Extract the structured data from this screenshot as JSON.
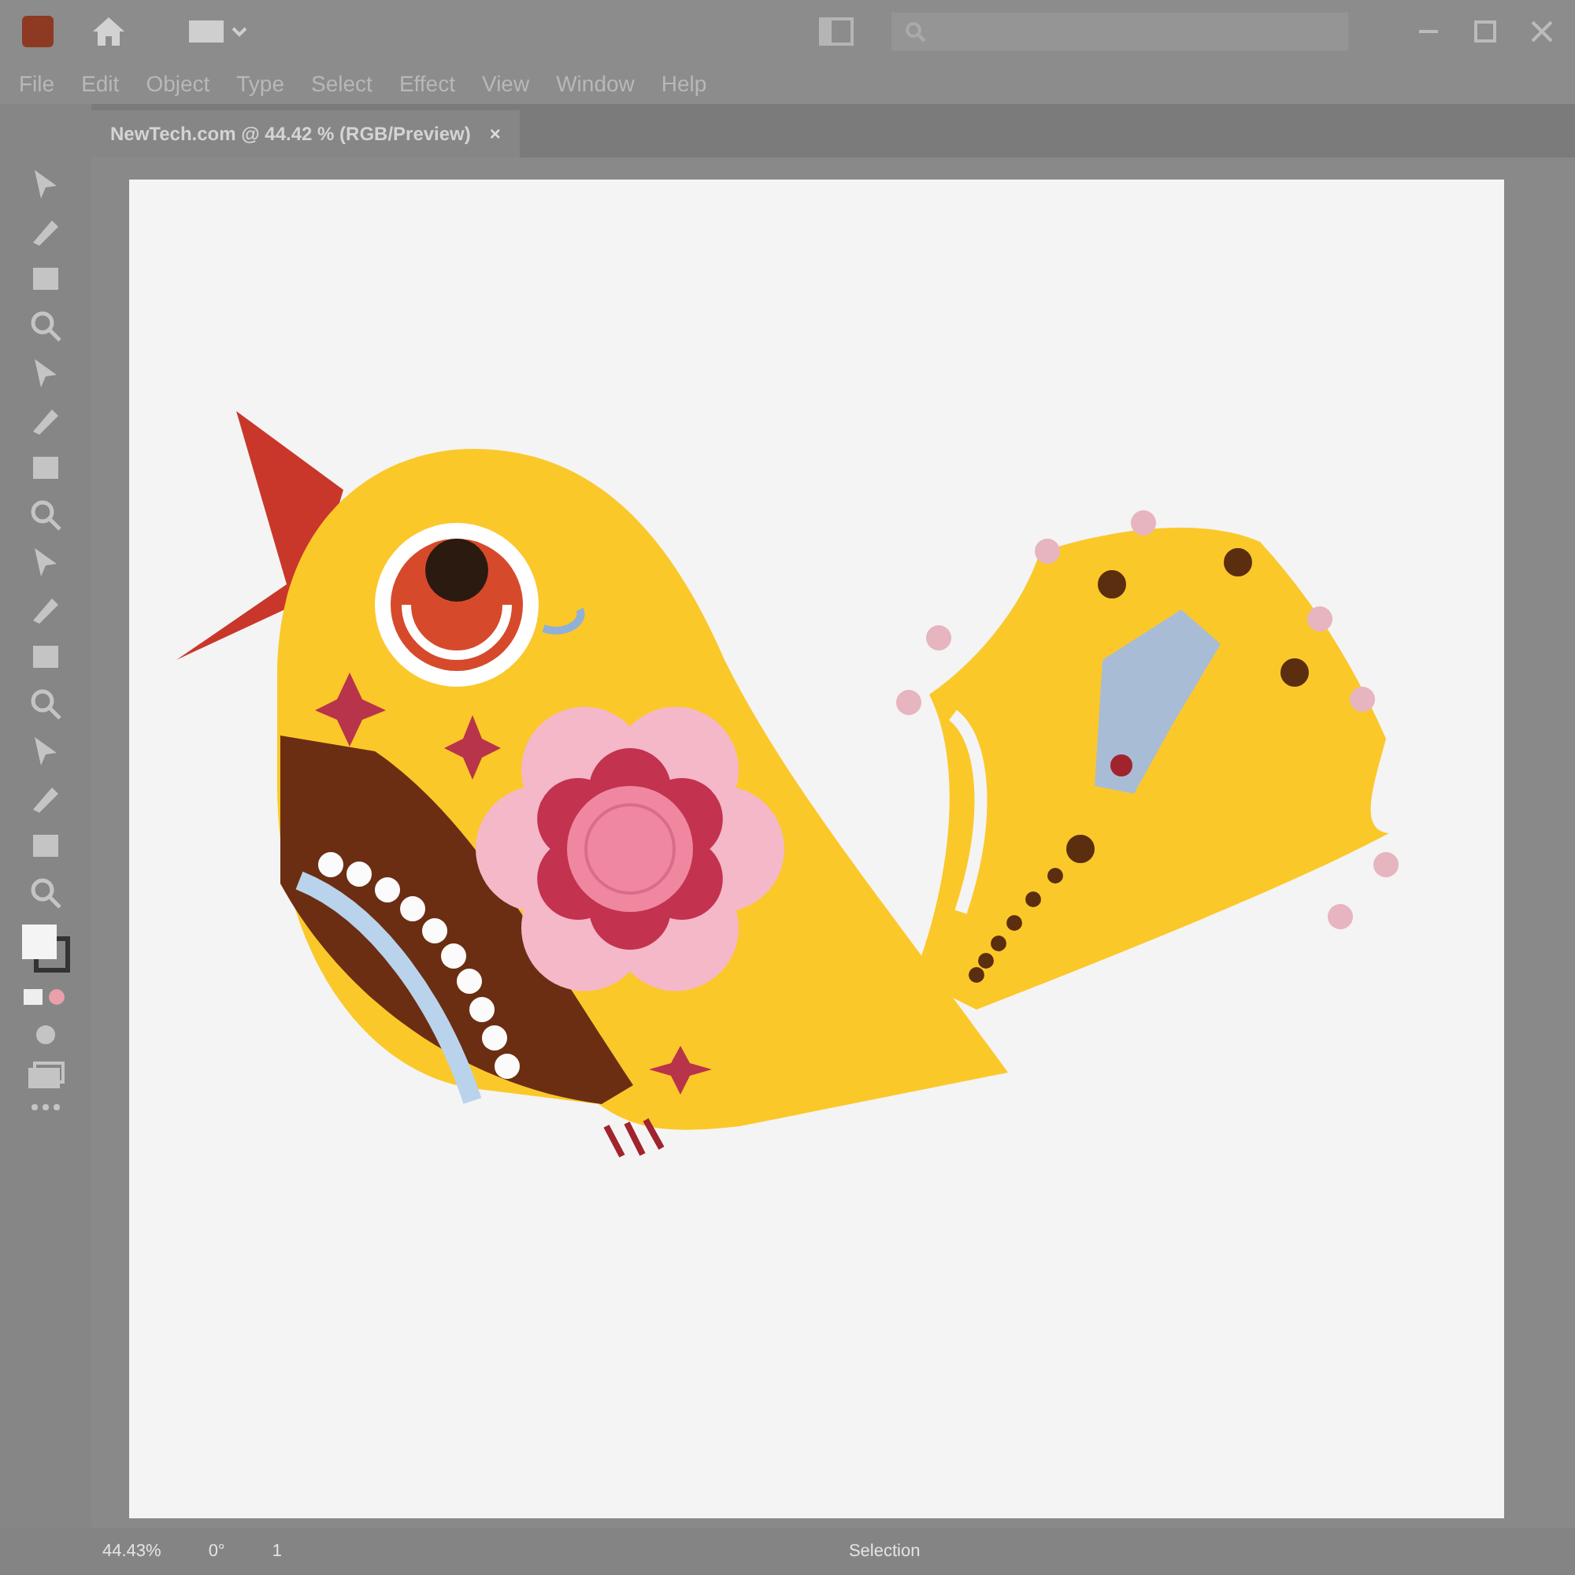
{
  "menu": [
    {
      "label": "File"
    },
    {
      "label": "Edit"
    },
    {
      "label": "Object"
    },
    {
      "label": "Type"
    },
    {
      "label": "Select"
    },
    {
      "label": "Effect"
    },
    {
      "label": "View"
    },
    {
      "label": "Window"
    },
    {
      "label": "Help"
    }
  ],
  "document_tab": {
    "title": "NewTech.com @ 44.42 % (RGB/Preview)",
    "close": "×"
  },
  "status_bar": {
    "zoom": "44.43%",
    "rotation": "0°",
    "artboard": "1",
    "tool": "Selection"
  }
}
